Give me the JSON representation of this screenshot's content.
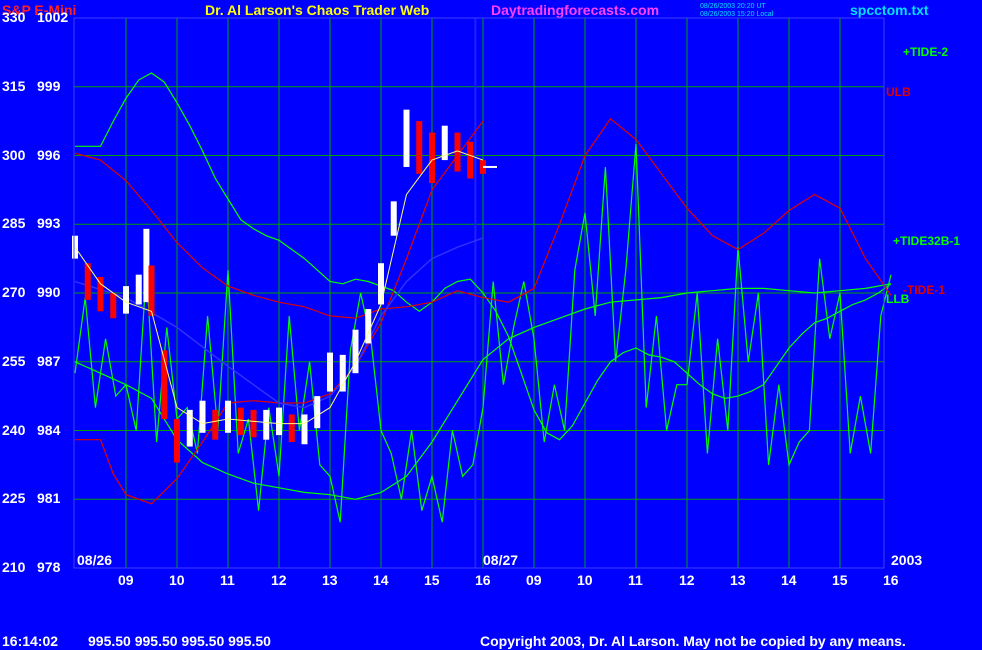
{
  "header": {
    "instrument": "S&P E-Mini",
    "title": "Dr. Al Larson's Chaos Trader Web",
    "site": "Daytradingforecasts.com",
    "stamp_line1": "08/26/2003 20:20 UT",
    "stamp_line2": "08/26/2003 15:20 Local",
    "file": "spcctom.txt"
  },
  "footer": {
    "time": "16:14:02",
    "quote": "995.50 995.50 995.50 995.50",
    "copyright": "Copyright 2003, Dr. Al Larson. May not be copied by any means."
  },
  "colors": {
    "background": "#0000ff",
    "grid": "#00a000",
    "price_up": "#ffffff",
    "price_down": "#ff0000",
    "tide": "#00ff00",
    "band": "#e00000",
    "title_red": "#ff2020",
    "title_yellow": "#ffff00",
    "title_magenta": "#ff40ff",
    "stamp_cyan": "#00e0ff"
  },
  "chart_data": {
    "type": "line",
    "y_left_labels": [
      "330",
      "315",
      "300",
      "285",
      "270",
      "255",
      "240",
      "225",
      "210"
    ],
    "y_right_labels": [
      "1002",
      "999",
      "996",
      "993",
      "990",
      "987",
      "984",
      "981",
      "978"
    ],
    "ylim": [
      978,
      1002
    ],
    "x_hours": [
      "09",
      "10",
      "11",
      "12",
      "13",
      "14",
      "15",
      "16",
      "09",
      "10",
      "11",
      "12",
      "13",
      "14",
      "15",
      "16"
    ],
    "x_dates": [
      "08/26",
      "08/27"
    ],
    "year": "2003",
    "series_labels": [
      "+TIDE-2",
      "ULB",
      "+TIDE32B-1",
      "-TIDE-1",
      "LLB"
    ],
    "grid": true,
    "series": [
      {
        "name": "+TIDE-2",
        "color": "#00ff00",
        "x": [
          0,
          0.5,
          0.75,
          1,
          1.25,
          1.5,
          1.75,
          2,
          2.25,
          2.5,
          2.75,
          3,
          3.25,
          3.5,
          3.75,
          4,
          4.25,
          4.5,
          4.75,
          5,
          5.25,
          5.5,
          5.75,
          6,
          6.25,
          6.5,
          6.75,
          7,
          7.25,
          7.5,
          7.75,
          8,
          8.25,
          8.5,
          8.75,
          9,
          9.25,
          9.5,
          9.75,
          10,
          10.25,
          10.5,
          10.75,
          11,
          11.25,
          11.5,
          11.75,
          12,
          12.25,
          12.5,
          12.75,
          13,
          13.25,
          13.5,
          13.75,
          14,
          14.25,
          14.5,
          14.75,
          15,
          15.25,
          15.5,
          15.75,
          16
        ],
        "values": [
          996.4,
          996.4,
          997.5,
          998.5,
          999.3,
          999.6,
          999.2,
          998.3,
          997.3,
          996.2,
          995.0,
          994.1,
          993.2,
          992.8,
          992.5,
          992.3,
          991.9,
          991.5,
          991.0,
          990.5,
          990.4,
          990.6,
          990.5,
          990.3,
          990.1,
          989.6,
          989.2,
          989.6,
          990.2,
          990.5,
          990.6,
          990.0,
          989.2,
          988.1,
          986.5,
          984.9,
          983.9,
          983.6,
          984.2,
          985.2,
          986.2,
          987.0,
          987.4,
          987.6,
          987.3,
          987.2,
          987.0,
          986.5,
          986.0,
          985.6,
          985.4,
          985.5,
          985.7,
          986.0,
          986.8,
          987.6,
          988.2,
          988.7,
          988.9,
          989.2,
          989.5,
          989.7,
          990.0,
          990.4
        ]
      },
      {
        "name": "LLB",
        "color": "#00ff00",
        "x": [
          0,
          0.5,
          1,
          1.5,
          2,
          2.5,
          3,
          3.5,
          4,
          4.5,
          5,
          5.5,
          6,
          6.5,
          7,
          7.5,
          8,
          8.5,
          9,
          9.5,
          10,
          10.5,
          11,
          11.5,
          12,
          12.5,
          13,
          13.5,
          14,
          14.5,
          15,
          15.5,
          16
        ],
        "values": [
          987.0,
          986.5,
          986.0,
          985.4,
          983.6,
          982.6,
          982.1,
          981.7,
          981.5,
          981.3,
          981.2,
          981.0,
          981.3,
          982.0,
          983.5,
          985.3,
          987.1,
          988.0,
          988.5,
          988.9,
          989.3,
          989.6,
          989.7,
          989.8,
          990.0,
          990.1,
          990.2,
          990.2,
          990.1,
          990.0,
          990.1,
          990.2,
          990.4
        ]
      },
      {
        "name": "+TIDE32B-1",
        "color": "#00ff00",
        "x": [
          0,
          0.2,
          0.4,
          0.6,
          0.8,
          1,
          1.2,
          1.4,
          1.6,
          1.8,
          2,
          2.2,
          2.4,
          2.6,
          2.8,
          3,
          3.2,
          3.4,
          3.6,
          3.8,
          4,
          4.2,
          4.4,
          4.6,
          4.8,
          5,
          5.2,
          5.4,
          5.6,
          5.8,
          6,
          6.2,
          6.4,
          6.6,
          6.8,
          7,
          7.2,
          7.4,
          7.6,
          7.8,
          8,
          8.2,
          8.4,
          8.6,
          8.8,
          9,
          9.2,
          9.4,
          9.6,
          9.8,
          10,
          10.2,
          10.4,
          10.6,
          10.8,
          11,
          11.2,
          11.4,
          11.6,
          11.8,
          12,
          12.2,
          12.4,
          12.6,
          12.8,
          13,
          13.2,
          13.4,
          13.6,
          13.8,
          14,
          14.2,
          14.4,
          14.6,
          14.8,
          15,
          15.2,
          15.4,
          15.6,
          15.8,
          16
        ],
        "values": [
          986.5,
          989.8,
          985.0,
          988.0,
          985.5,
          986.0,
          984.0,
          991.0,
          983.5,
          988.5,
          984.5,
          985.0,
          983.0,
          989.0,
          984.0,
          991.0,
          983.0,
          984.5,
          980.5,
          985.0,
          982.0,
          989.0,
          984.0,
          987.0,
          982.5,
          982.0,
          980.0,
          987.5,
          990.0,
          988.0,
          984.0,
          983.0,
          981.0,
          984.0,
          980.5,
          982.0,
          980.0,
          984.0,
          982.0,
          982.5,
          985.0,
          990.5,
          986.0,
          988.5,
          990.5,
          988.0,
          983.5,
          986.0,
          984.0,
          991.0,
          993.5,
          989.0,
          995.5,
          987.0,
          991.0,
          996.5,
          985.0,
          989.0,
          984.0,
          986.0,
          986.0,
          990.0,
          983.0,
          988.0,
          984.0,
          992.0,
          987.0,
          990.0,
          982.5,
          986.0,
          982.5,
          983.5,
          984.0,
          991.5,
          988.0,
          990.0,
          983.0,
          985.5,
          983.0,
          989.0,
          990.8
        ]
      },
      {
        "name": "ULB",
        "color": "#e00000",
        "x": [
          0,
          0.5,
          1,
          1.5,
          2,
          2.5,
          3,
          3.5,
          4,
          4.5,
          5,
          5.5,
          6,
          6.5,
          7,
          7.5,
          8,
          8.5,
          9,
          9.5,
          10,
          10.5,
          11,
          11.5,
          12,
          12.5,
          13,
          13.5,
          14,
          14.5,
          15,
          15.5,
          16
        ],
        "values": [
          996.1,
          995.8,
          994.9,
          993.6,
          992.2,
          991.1,
          990.3,
          989.9,
          989.6,
          989.4,
          989.0,
          988.9,
          989.3,
          989.4,
          989.6,
          990.1,
          989.8,
          989.6,
          990.2,
          993.0,
          996.0,
          997.6,
          996.7,
          995.2,
          993.7,
          992.5,
          991.9,
          992.6,
          993.6,
          994.3,
          993.7,
          991.5,
          989.9
        ]
      },
      {
        "name": "-TIDE-1",
        "color": "#e00000",
        "x": [
          0,
          0.5,
          0.75,
          1,
          1.5,
          2,
          2.5,
          3,
          3.5,
          4,
          4.5,
          5,
          5.5,
          6,
          6.5,
          7,
          7.5,
          8
        ],
        "values": [
          983.6,
          983.6,
          982.1,
          981.2,
          980.8,
          981.9,
          983.5,
          985.2,
          985.3,
          985.2,
          985.2,
          985.6,
          986.8,
          988.7,
          991.5,
          994.5,
          996.0,
          997.5
        ]
      }
    ],
    "price": {
      "x": [
        0,
        0.25,
        0.5,
        0.75,
        1,
        1.25,
        1.4,
        1.5,
        1.75,
        2,
        2.25,
        2.5,
        2.75,
        3,
        3.25,
        3.5,
        3.75,
        4,
        4.25,
        4.5,
        4.75,
        5,
        5.25,
        5.5,
        5.75,
        6,
        6.25,
        6.5,
        6.75,
        7,
        7.25,
        7.5,
        7.75,
        8
      ],
      "close": [
        992.0,
        990.6,
        990.2,
        989.5,
        989.8,
        990.1,
        990.6,
        989.6,
        985.4,
        983.6,
        984.0,
        984.5,
        984.3,
        984.6,
        984.4,
        984.2,
        984.3,
        984.4,
        984.1,
        984.1,
        984.8,
        986.0,
        986.3,
        987.3,
        988.5,
        990.0,
        993.0,
        996.5,
        995.8,
        995.5,
        996.6,
        996.2,
        995.8,
        995.5
      ],
      "high": [
        992.5,
        991.3,
        990.7,
        990.0,
        990.3,
        990.8,
        992.8,
        991.2,
        987.5,
        984.5,
        984.9,
        985.3,
        984.9,
        985.3,
        985.0,
        984.9,
        984.9,
        985.0,
        984.7,
        984.7,
        985.5,
        987.4,
        987.3,
        988.4,
        989.3,
        991.3,
        994.0,
        998.0,
        997.5,
        997.0,
        997.3,
        997.0,
        996.6,
        995.8
      ],
      "low": [
        991.5,
        989.7,
        989.2,
        988.9,
        989.1,
        989.5,
        989.6,
        989.0,
        984.5,
        982.6,
        983.3,
        983.9,
        983.6,
        983.9,
        983.8,
        983.7,
        983.6,
        983.8,
        983.5,
        983.4,
        984.1,
        985.7,
        985.7,
        986.5,
        987.8,
        989.5,
        992.5,
        995.5,
        995.2,
        994.8,
        995.8,
        995.3,
        995.0,
        995.2
      ]
    },
    "price_average": {
      "x": [
        0,
        0.5,
        1,
        1.5,
        2,
        2.5,
        3,
        3.5,
        4,
        4.5,
        5,
        5.5,
        6,
        6.5,
        7,
        7.5,
        8
      ],
      "values": [
        992.0,
        990.4,
        989.6,
        989.2,
        985.0,
        984.3,
        984.5,
        984.4,
        984.3,
        984.3,
        985.0,
        987.0,
        989.5,
        994.3,
        995.8,
        996.2,
        995.8
      ]
    },
    "price_trend": {
      "x": [
        0,
        1,
        2,
        3,
        4,
        4.5,
        5,
        5.5,
        6,
        6.5,
        7,
        7.5,
        8
      ],
      "values": [
        990.5,
        989.8,
        988.5,
        986.8,
        985.2,
        985.0,
        985.5,
        986.8,
        989.0,
        990.5,
        991.5,
        992.0,
        992.4
      ]
    }
  }
}
